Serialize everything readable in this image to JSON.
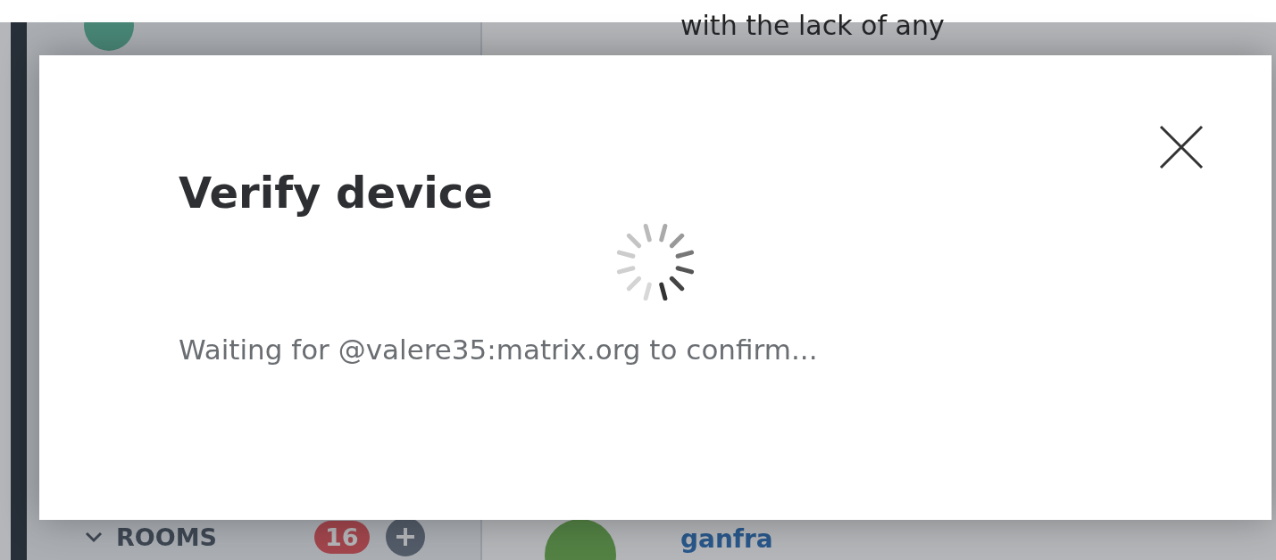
{
  "background": {
    "message_text": "with the lack of any",
    "rooms_section": {
      "label": "ROOMS",
      "unread_count": "16"
    },
    "sender_name": "ganfra"
  },
  "dialog": {
    "title": "Verify device",
    "status": "Waiting for @valere35:matrix.org to confirm..."
  }
}
